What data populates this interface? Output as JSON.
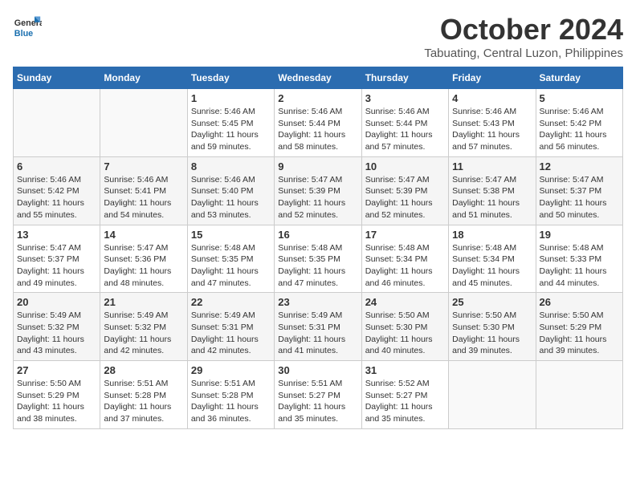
{
  "header": {
    "logo_line1": "General",
    "logo_line2": "Blue",
    "month": "October 2024",
    "location": "Tabuating, Central Luzon, Philippines"
  },
  "days_of_week": [
    "Sunday",
    "Monday",
    "Tuesday",
    "Wednesday",
    "Thursday",
    "Friday",
    "Saturday"
  ],
  "weeks": [
    [
      {
        "day": "",
        "info": ""
      },
      {
        "day": "",
        "info": ""
      },
      {
        "day": "1",
        "info": "Sunrise: 5:46 AM\nSunset: 5:45 PM\nDaylight: 11 hours and 59 minutes."
      },
      {
        "day": "2",
        "info": "Sunrise: 5:46 AM\nSunset: 5:44 PM\nDaylight: 11 hours and 58 minutes."
      },
      {
        "day": "3",
        "info": "Sunrise: 5:46 AM\nSunset: 5:44 PM\nDaylight: 11 hours and 57 minutes."
      },
      {
        "day": "4",
        "info": "Sunrise: 5:46 AM\nSunset: 5:43 PM\nDaylight: 11 hours and 57 minutes."
      },
      {
        "day": "5",
        "info": "Sunrise: 5:46 AM\nSunset: 5:42 PM\nDaylight: 11 hours and 56 minutes."
      }
    ],
    [
      {
        "day": "6",
        "info": "Sunrise: 5:46 AM\nSunset: 5:42 PM\nDaylight: 11 hours and 55 minutes."
      },
      {
        "day": "7",
        "info": "Sunrise: 5:46 AM\nSunset: 5:41 PM\nDaylight: 11 hours and 54 minutes."
      },
      {
        "day": "8",
        "info": "Sunrise: 5:46 AM\nSunset: 5:40 PM\nDaylight: 11 hours and 53 minutes."
      },
      {
        "day": "9",
        "info": "Sunrise: 5:47 AM\nSunset: 5:39 PM\nDaylight: 11 hours and 52 minutes."
      },
      {
        "day": "10",
        "info": "Sunrise: 5:47 AM\nSunset: 5:39 PM\nDaylight: 11 hours and 52 minutes."
      },
      {
        "day": "11",
        "info": "Sunrise: 5:47 AM\nSunset: 5:38 PM\nDaylight: 11 hours and 51 minutes."
      },
      {
        "day": "12",
        "info": "Sunrise: 5:47 AM\nSunset: 5:37 PM\nDaylight: 11 hours and 50 minutes."
      }
    ],
    [
      {
        "day": "13",
        "info": "Sunrise: 5:47 AM\nSunset: 5:37 PM\nDaylight: 11 hours and 49 minutes."
      },
      {
        "day": "14",
        "info": "Sunrise: 5:47 AM\nSunset: 5:36 PM\nDaylight: 11 hours and 48 minutes."
      },
      {
        "day": "15",
        "info": "Sunrise: 5:48 AM\nSunset: 5:35 PM\nDaylight: 11 hours and 47 minutes."
      },
      {
        "day": "16",
        "info": "Sunrise: 5:48 AM\nSunset: 5:35 PM\nDaylight: 11 hours and 47 minutes."
      },
      {
        "day": "17",
        "info": "Sunrise: 5:48 AM\nSunset: 5:34 PM\nDaylight: 11 hours and 46 minutes."
      },
      {
        "day": "18",
        "info": "Sunrise: 5:48 AM\nSunset: 5:34 PM\nDaylight: 11 hours and 45 minutes."
      },
      {
        "day": "19",
        "info": "Sunrise: 5:48 AM\nSunset: 5:33 PM\nDaylight: 11 hours and 44 minutes."
      }
    ],
    [
      {
        "day": "20",
        "info": "Sunrise: 5:49 AM\nSunset: 5:32 PM\nDaylight: 11 hours and 43 minutes."
      },
      {
        "day": "21",
        "info": "Sunrise: 5:49 AM\nSunset: 5:32 PM\nDaylight: 11 hours and 42 minutes."
      },
      {
        "day": "22",
        "info": "Sunrise: 5:49 AM\nSunset: 5:31 PM\nDaylight: 11 hours and 42 minutes."
      },
      {
        "day": "23",
        "info": "Sunrise: 5:49 AM\nSunset: 5:31 PM\nDaylight: 11 hours and 41 minutes."
      },
      {
        "day": "24",
        "info": "Sunrise: 5:50 AM\nSunset: 5:30 PM\nDaylight: 11 hours and 40 minutes."
      },
      {
        "day": "25",
        "info": "Sunrise: 5:50 AM\nSunset: 5:30 PM\nDaylight: 11 hours and 39 minutes."
      },
      {
        "day": "26",
        "info": "Sunrise: 5:50 AM\nSunset: 5:29 PM\nDaylight: 11 hours and 39 minutes."
      }
    ],
    [
      {
        "day": "27",
        "info": "Sunrise: 5:50 AM\nSunset: 5:29 PM\nDaylight: 11 hours and 38 minutes."
      },
      {
        "day": "28",
        "info": "Sunrise: 5:51 AM\nSunset: 5:28 PM\nDaylight: 11 hours and 37 minutes."
      },
      {
        "day": "29",
        "info": "Sunrise: 5:51 AM\nSunset: 5:28 PM\nDaylight: 11 hours and 36 minutes."
      },
      {
        "day": "30",
        "info": "Sunrise: 5:51 AM\nSunset: 5:27 PM\nDaylight: 11 hours and 35 minutes."
      },
      {
        "day": "31",
        "info": "Sunrise: 5:52 AM\nSunset: 5:27 PM\nDaylight: 11 hours and 35 minutes."
      },
      {
        "day": "",
        "info": ""
      },
      {
        "day": "",
        "info": ""
      }
    ]
  ]
}
